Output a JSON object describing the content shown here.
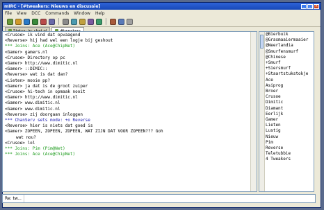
{
  "window": {
    "title": "mIRC - [#tweakers: Nieuws en discussie]"
  },
  "menu": [
    "File",
    "View",
    "DCC",
    "Commands",
    "Window",
    "Help"
  ],
  "toolbar": {
    "icon_colors": [
      "#6a9a3a",
      "#d09a2a",
      "#2a7ac8",
      "#3a8a3a",
      "#b84a4a",
      "#6a6aa8",
      "#8a8a8a",
      "#4a9ab0",
      "#c0a040",
      "#7a5aa0",
      "#3a9a6a",
      "#a85a3a",
      "#5a7ab8",
      "#a0a0a0"
    ]
  },
  "tabs": [
    {
      "label": "Status: irc.chat.nl",
      "active": false
    },
    {
      "label": "#tweakers",
      "active": true
    }
  ],
  "chat": {
    "lines": [
      {
        "text": "<Crusoe> ik vind dat opvaagend",
        "type": "msg"
      },
      {
        "text": "<Reverse> hij had wel een logje bij geshout",
        "type": "msg"
      },
      {
        "text": "*** Joins: Ace (Ace@ChipNet)",
        "type": "join"
      },
      {
        "text": "<Gamer> gamers.nl",
        "type": "msg"
      },
      {
        "text": "<Crusoe> Directory op pc",
        "type": "msg"
      },
      {
        "text": "<Gamer> http://www.dimitic.nl",
        "type": "msg"
      },
      {
        "text": "<Gamer> ::DIMIC::",
        "type": "msg"
      },
      {
        "text": "<Reverse> wat is dat dan?",
        "type": "msg"
      },
      {
        "text": "<Lieten> mooie pp?",
        "type": "msg"
      },
      {
        "text": "<Gamer> ja dat is de groot zuiper",
        "type": "msg"
      },
      {
        "text": "<Crusoe> hi-tech in opmaak nooit",
        "type": "msg"
      },
      {
        "text": "<Gamer> http://www.dimitic.nl",
        "type": "msg"
      },
      {
        "text": "<Gamer> www.dimitic.nl",
        "type": "msg"
      },
      {
        "text": "<Gamer> www.dimitic.nl",
        "type": "msg"
      },
      {
        "text": "<Reverse> zij doorgaan inloggen",
        "type": "msg"
      },
      {
        "text": "*** ChanServ sets mode: +o Reverse",
        "type": "mode"
      },
      {
        "text": "<Reverse> hier is niets dat goed is",
        "type": "msg"
      },
      {
        "text": "<Gamer> ZOPEEN, ZOPEEN, ZOPEEN, WAT ZIJN DAT VOOR ZOPEEN??? Goh",
        "type": "msg"
      },
      {
        "text": "wat nou?",
        "type": "cont"
      },
      {
        "text": "<Crusoe> lol",
        "type": "msg"
      },
      {
        "text": "*** Joins: Pim (Pim@Net)",
        "type": "join"
      },
      {
        "text": "*** Joins: Ace (Ace@ChipNet)",
        "type": "join"
      }
    ]
  },
  "nicklist": {
    "nicks": [
      "@Bierbuik",
      "@Grasmaaiermaaier",
      "@Neerlandia",
      "@Smurfensmurf",
      "@Chinese",
      "+Smurf",
      "+Siersmurf",
      "+Staartstukstokje",
      "Ace",
      "Asiprog",
      "Broer",
      "Crusoe",
      "Dimitic",
      "Diamant",
      "Eerlijk",
      "Gamer",
      "Lieten",
      "Lustig",
      "Nieuw",
      "Pim",
      "Reverse",
      "Teletubbie",
      "4 Tweakers"
    ]
  },
  "input": {
    "prompt": "Re: tw...",
    "value": ""
  }
}
